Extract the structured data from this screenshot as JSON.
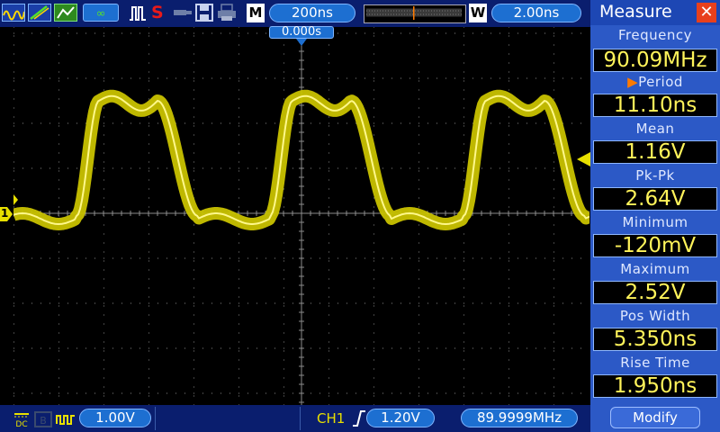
{
  "toolbar": {
    "timebase": "200ns",
    "mode_label": "M",
    "window_label": "W",
    "window_value": "2.00ns",
    "recording_label": "S",
    "trigger_position": "0.000s"
  },
  "bottombar": {
    "ch1_scale": "1.00V",
    "trigger_source": "CH1",
    "trigger_level": "1.20V",
    "frequency_counter": "89.9999MHz"
  },
  "measure": {
    "title": "Measure",
    "close_icon": "close-icon",
    "selected_marker": "▶",
    "items": [
      {
        "label": "Frequency",
        "value": "90.09MHz"
      },
      {
        "label": "Period",
        "value": "11.10ns"
      },
      {
        "label": "Mean",
        "value": "1.16V"
      },
      {
        "label": "Pk-Pk",
        "value": "2.64V"
      },
      {
        "label": "Minimum",
        "value": "-120mV"
      },
      {
        "label": "Maximum",
        "value": "2.52V"
      },
      {
        "label": "Pos Width",
        "value": "5.350ns"
      },
      {
        "label": "Rise Time",
        "value": "1.950ns"
      }
    ],
    "modify_label": "Modify"
  },
  "channel": {
    "marker": "1",
    "color": "#e8e000"
  },
  "colors": {
    "trace": "#c9c200",
    "trace_center": "#fff88a",
    "grid": "#6b6b6b",
    "accent": "#1d6fd1"
  },
  "icons": [
    "waveform-icon",
    "ramp-icon",
    "persistence-icon",
    "cursor-icon",
    "pulse-icon",
    "usb-icon",
    "save-icon",
    "print-icon"
  ]
}
